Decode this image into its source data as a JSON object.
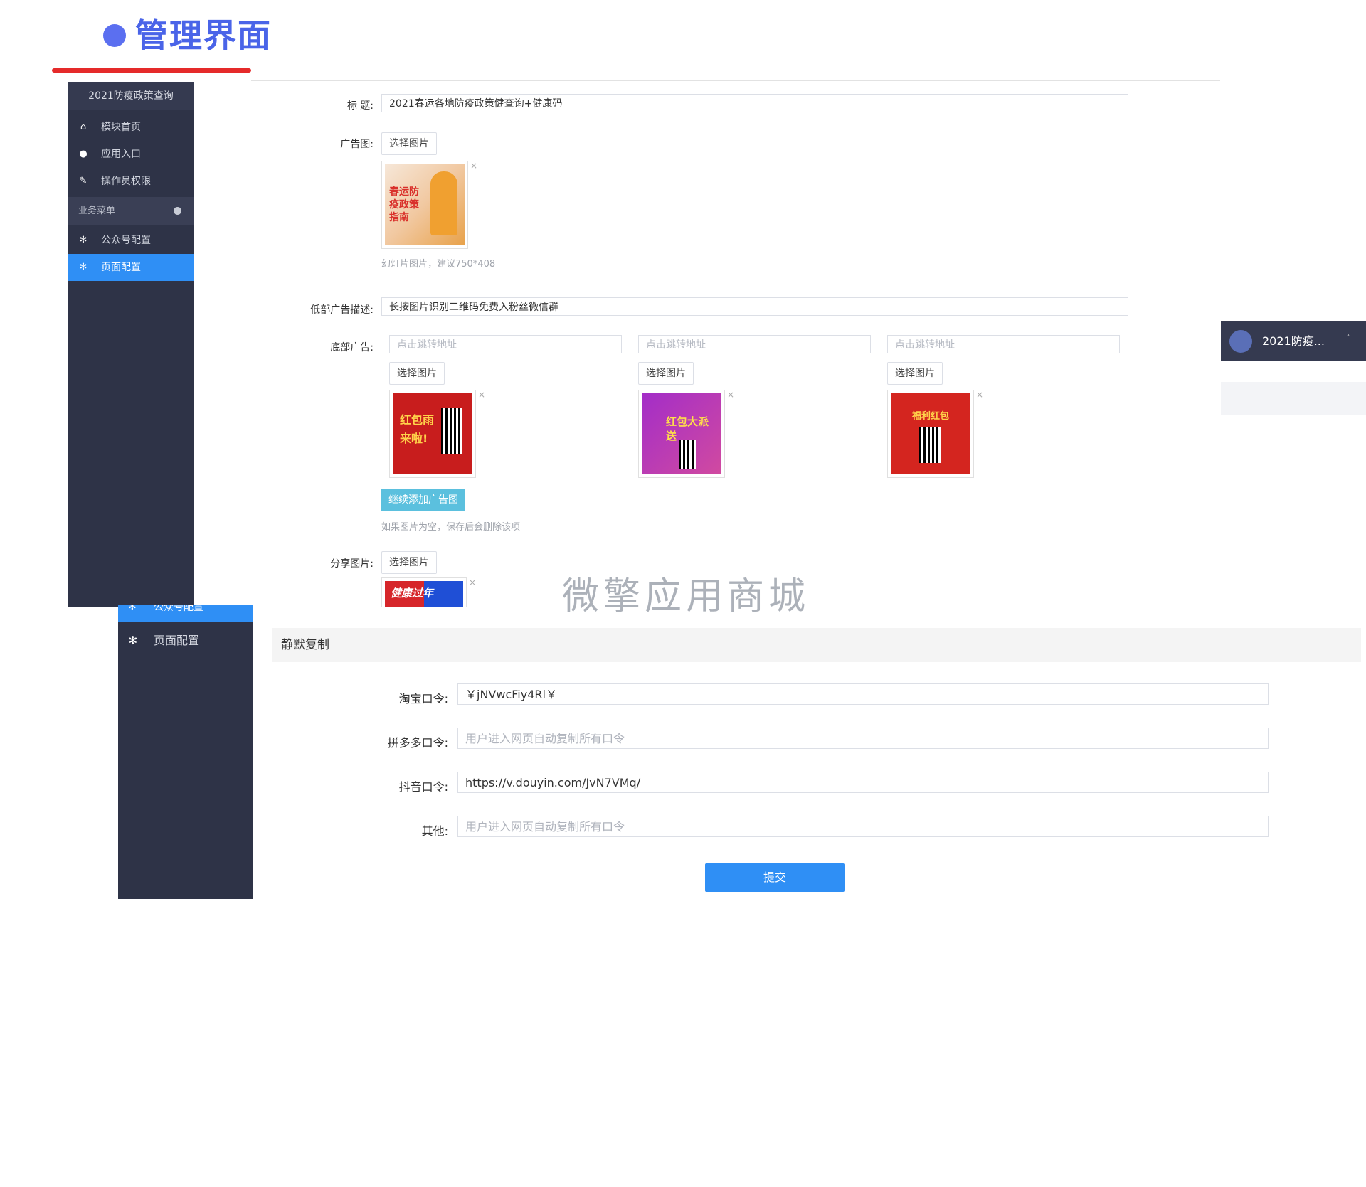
{
  "header": {
    "title": "管理界面"
  },
  "sidebar": {
    "title": "2021防疫政策查询",
    "items": [
      {
        "label": "模块首页",
        "icon": "home-icon"
      },
      {
        "label": "应用入口",
        "icon": "chat-icon"
      },
      {
        "label": "操作员权限",
        "icon": "edit-icon"
      }
    ],
    "section": "业务菜单",
    "sub_items": [
      {
        "label": "公众号配置",
        "icon": "gear-icon"
      },
      {
        "label": "页面配置",
        "icon": "gear-icon",
        "active": true
      }
    ]
  },
  "form": {
    "title_label": "标 题:",
    "title_value": "2021春运各地防疫政策健查询+健康码",
    "ad_label": "广告图:",
    "select_image": "选择图片",
    "ad_thumb_text": "春运防疫政策指南",
    "ad_hint": "幻灯片图片，建议750*408",
    "bottom_desc_label": "低部广告描述:",
    "bottom_desc_value": "长按图片识别二维码免费入粉丝微信群",
    "bottom_ad_label": "底部广告:",
    "bottom_ads": [
      {
        "placeholder": "点击跳转地址",
        "select": "选择图片",
        "text": "红包雨来啦!"
      },
      {
        "placeholder": "点击跳转地址",
        "select": "选择图片",
        "text": "红包大派送"
      },
      {
        "placeholder": "点击跳转地址",
        "select": "选择图片",
        "text": "福利红包"
      }
    ],
    "add_button": "继续添加广告图",
    "add_hint": "如果图片为空，保存后会删除该项",
    "share_label": "分享图片:",
    "share_select": "选择图片",
    "share_thumb_text": "健康过年"
  },
  "float_tab": {
    "label": "2021防疫...",
    "caret": "˄"
  },
  "watermark": "微擎应用商城",
  "sidebar2": {
    "top_label": "公众号配置",
    "item": {
      "label": "页面配置",
      "icon": "gear-icon"
    }
  },
  "silent_copy": {
    "heading": "静默复制",
    "fields": [
      {
        "label": "淘宝口令:",
        "value": "￥jNVwcFiy4Rl￥",
        "placeholder": ""
      },
      {
        "label": "拼多多口令:",
        "value": "",
        "placeholder": "用户进入网页自动复制所有口令"
      },
      {
        "label": "抖音口令:",
        "value": "https://v.douyin.com/JvN7VMq/",
        "placeholder": ""
      },
      {
        "label": "其他:",
        "value": "",
        "placeholder": "用户进入网页自动复制所有口令"
      }
    ],
    "submit": "提交"
  },
  "colors": {
    "accent": "#2f8ff5",
    "sidebar": "#2e3347",
    "title": "#4a64e8",
    "underline": "#e52a2a"
  }
}
